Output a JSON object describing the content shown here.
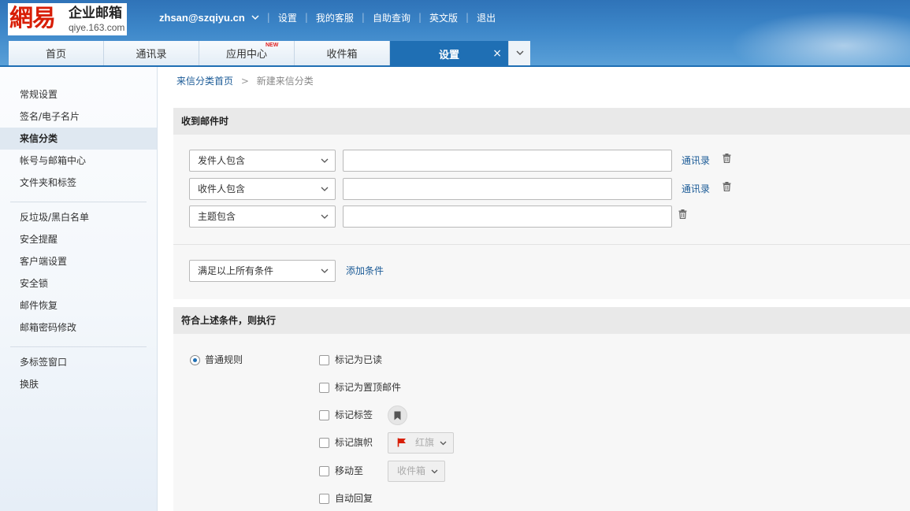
{
  "logo": {
    "mark": "網易",
    "name": "企业邮箱",
    "domain": "qiye.163.com"
  },
  "topnav": {
    "user": "zhsan@szqiyu.cn",
    "links": [
      "设置",
      "我的客服",
      "自助查询",
      "英文版",
      "退出"
    ]
  },
  "tabs": [
    {
      "label": "首页"
    },
    {
      "label": "通讯录"
    },
    {
      "label": "应用中心",
      "badge": "NEW"
    },
    {
      "label": "收件箱"
    },
    {
      "label": "设置",
      "close": "×"
    }
  ],
  "sidebar": {
    "group1": [
      "常规设置",
      "签名/电子名片",
      "来信分类",
      "帐号与邮箱中心",
      "文件夹和标签"
    ],
    "group2": [
      "反垃圾/黑白名单",
      "安全提醒",
      "客户端设置",
      "安全锁",
      "邮件恢复",
      "邮箱密码修改"
    ],
    "group3": [
      "多标签窗口",
      "换肤"
    ],
    "active": "来信分类"
  },
  "breadcrumb": {
    "home": "来信分类首页",
    "arrow": ">",
    "current": "新建来信分类"
  },
  "conditions": {
    "title": "收到邮件时",
    "rows": [
      {
        "field": "发件人包含",
        "value": "",
        "contacts": "通讯录"
      },
      {
        "field": "收件人包含",
        "value": "",
        "contacts": "通讯录"
      },
      {
        "field": "主题包含",
        "value": ""
      }
    ],
    "match": "满足以上所有条件",
    "add": "添加条件"
  },
  "actions": {
    "title": "符合上述条件，则执行",
    "rule_type": "普通规则",
    "options": {
      "mark_read": "标记为已读",
      "pin_top": "标记为置顶邮件",
      "mark_tag": "标记标签",
      "mark_flag": "标记旗帜",
      "flag_value": "红旗",
      "move_to": "移动至",
      "folder_value": "收件箱",
      "auto_reply": "自动回复"
    }
  },
  "colors": {
    "brand_blue": "#1f6fb4",
    "link": "#1a5a96",
    "flag_red": "#d81e06"
  }
}
